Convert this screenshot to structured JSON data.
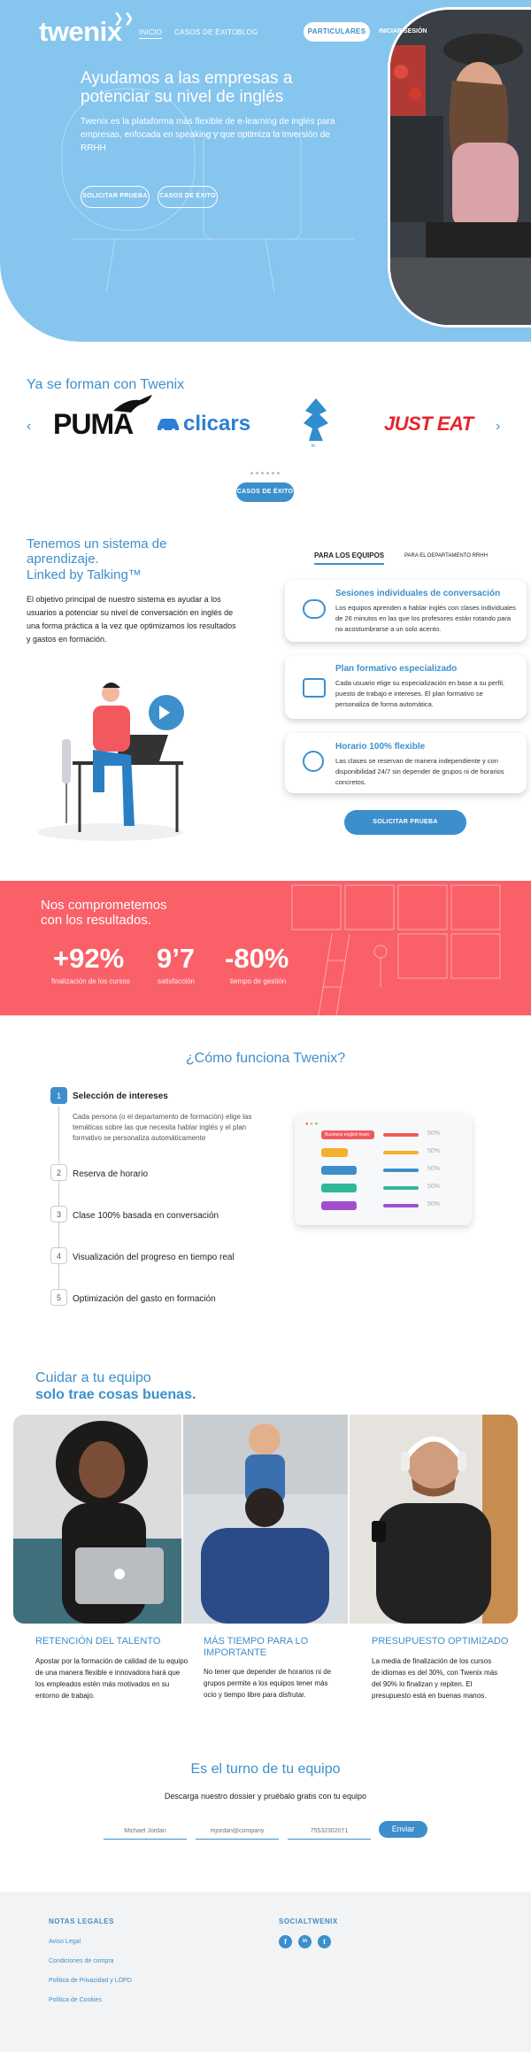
{
  "header": {
    "logo": "twenix",
    "nav": [
      "INICIO",
      "CASOS DE ÉXITO",
      "BLOG"
    ],
    "particulares_label": "PARTICULARES",
    "login_label": "INICIAR SESIÓN"
  },
  "hero": {
    "title": "Ayudamos a las empresas a potenciar su nivel de inglés",
    "subtitle": "Twenix es la plataforma más flexible de e-learning de inglés para empresas, enfocada en speaking y que optimiza la inversión de RRHH",
    "cta_primary": "SOLICITAR PRUEBA",
    "cta_secondary": "CASOS DE ÉXITO"
  },
  "clients": {
    "heading": "Ya se forman con Twenix",
    "logos": [
      "PUMA",
      "clicars",
      "HAVAS",
      "JUST EAT"
    ],
    "hava_small": "tn",
    "cta": "CASOS DE ÉXITO"
  },
  "system": {
    "title": "Tenemos un sistema de aprendizaje.",
    "title_bold": "Linked by Talking™",
    "text": "El objetivo principal de nuestro sistema es ayudar a los usuarios a potenciar su nivel de conversación en inglés de una forma  práctica a la vez que optimizamos los resultados y gastos en formación.",
    "tabs": [
      "PARA LOS EQUIPOS",
      "PARA EL DEPARTAMENTO RRHH"
    ],
    "cards": [
      {
        "title": "Sesiones individuales de conversación",
        "text": "Los equipos aprenden a hablar inglés con clases individuales de 26 minutos en las que los profesores están rotando para no acostumbrarse a un solo acento."
      },
      {
        "title": "Plan formativo especializado",
        "text": "Cada usuario elige su especialización en base a su perfil, puesto de trabajo e intereses. El plan formativo se personaliza de forma automática."
      },
      {
        "title": "Horario 100% flexible",
        "text": "Las clases se reservan de manera independiente y con disponibilidad 24/7 sin depender de grupos ni de horarios concretos."
      }
    ],
    "cta": "SOLICITAR PRUEBA"
  },
  "numbers": {
    "heading_1": "Nos comprometemos",
    "heading_2": "con los resultados.",
    "stats": [
      {
        "value": "+92%",
        "label": "finalización de los cursos"
      },
      {
        "value": "9’7",
        "label": "satisfacción"
      },
      {
        "value": "-80%",
        "label": "tiempo de gestión"
      }
    ]
  },
  "how": {
    "heading": "¿Cómo funciona Twenix?",
    "steps": [
      {
        "num": "1",
        "label": "Selección de intereses"
      },
      {
        "num": "2",
        "label": "Reserva de horario"
      },
      {
        "num": "3",
        "label": "Clase 100% basada en conversación"
      },
      {
        "num": "4",
        "label": "Visualización del progreso en tiempo real"
      },
      {
        "num": "5",
        "label": "Optimización del gasto en formación"
      }
    ],
    "step1_desc": "Cada persona (o el departamento de formación) elige las temáticas sobre las que necesita hablar inglés y el plan formativo se personaliza automáticamente",
    "mock_label": "Business english team",
    "mock_pcts": [
      "50%",
      "50%",
      "50%",
      "50%",
      "50%"
    ]
  },
  "care": {
    "heading_1": "Cuidar a tu equipo",
    "heading_2": "solo trae cosas buenas.",
    "columns": [
      {
        "title": "RETENCIÓN DEL TALENTO",
        "text": "Apostar por la formación de calidad de tu equipo de una manera flexible e innovadora hará que los empleados estén más motivados en su entorno de trabajo."
      },
      {
        "title": "MÁS TIEMPO PARA LO IMPORTANTE",
        "text": "No tener que depender de horarios ni de grupos permite a los equipos tener más ocio y tiempo libre para disfrutar."
      },
      {
        "title": "PRESUPUESTO OPTIMIZADO",
        "text": "La media de finalización de los cursos de idiomas es del 30%, con Twenix más del 90% lo finalizan y repiten. El presupuesto está en buenas manos."
      }
    ]
  },
  "contact": {
    "heading": "Es el turno de tu equipo",
    "subtitle": "Descarga nuestro dossier y pruébalo gratis con tu equipo",
    "name_placeholder": "Michael Jordan",
    "email_placeholder": "mjordan@company",
    "phone_placeholder": "755323020†1",
    "send": "Enviar"
  },
  "footer": {
    "legal_heading": "NOTAS LEGALES",
    "legal_links": [
      "Aviso Legal",
      "Condiciones de compra",
      "Política de Privacidad y LOPD",
      "Política de Cookies"
    ],
    "social_heading": "SOCIALTWENIX",
    "social": [
      "f",
      "in",
      "t"
    ]
  },
  "colors": {
    "primary": "#3d8fcc",
    "hero_bg": "#86c5ee",
    "coral": "#fa6068"
  }
}
